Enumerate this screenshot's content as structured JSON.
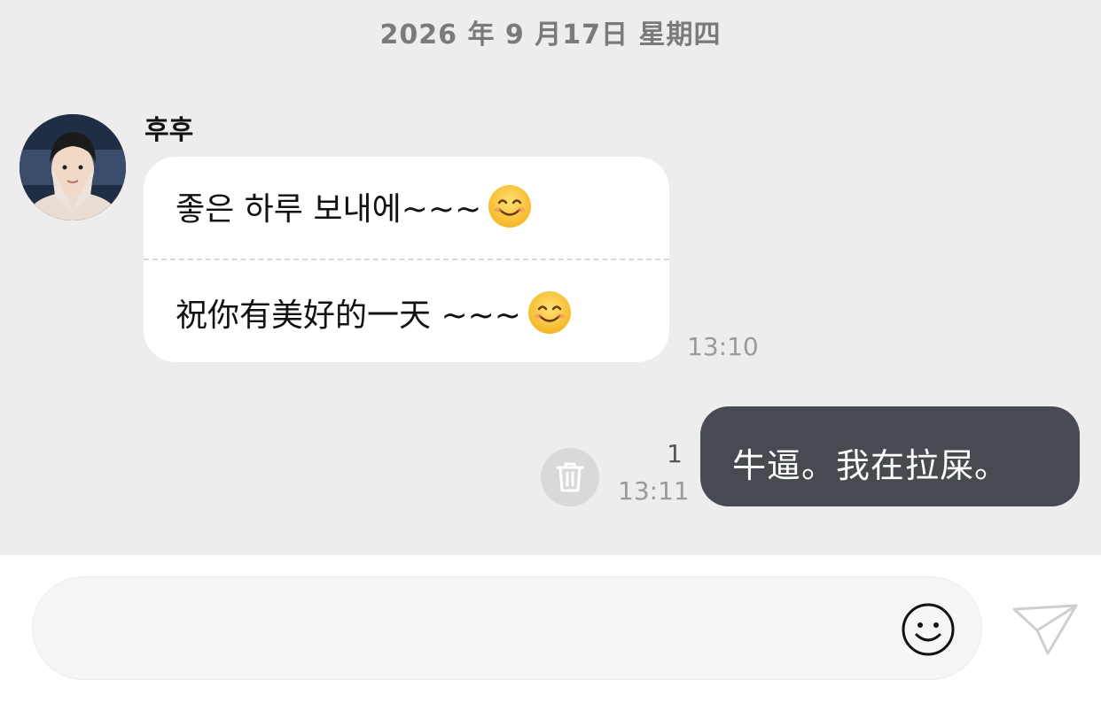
{
  "date_header": "2026 年 9 月17日 星期四",
  "incoming": {
    "sender_name": "후후",
    "lines": [
      "좋은 하루 보내에~~~",
      "祝你有美好的一天 ~~~"
    ],
    "emoji": "smiling-face-emoji",
    "time": "13:10"
  },
  "outgoing": {
    "text": "牛逼。我在拉屎。",
    "read_count": "1",
    "time": "13:11"
  },
  "input": {
    "placeholder": "",
    "emoji_icon": "smiley-icon",
    "send_icon": "paper-plane-icon"
  },
  "colors": {
    "background": "#ededed",
    "incoming_bubble": "#ffffff",
    "outgoing_bubble": "#474a51",
    "timestamp": "#9a9a9a"
  }
}
